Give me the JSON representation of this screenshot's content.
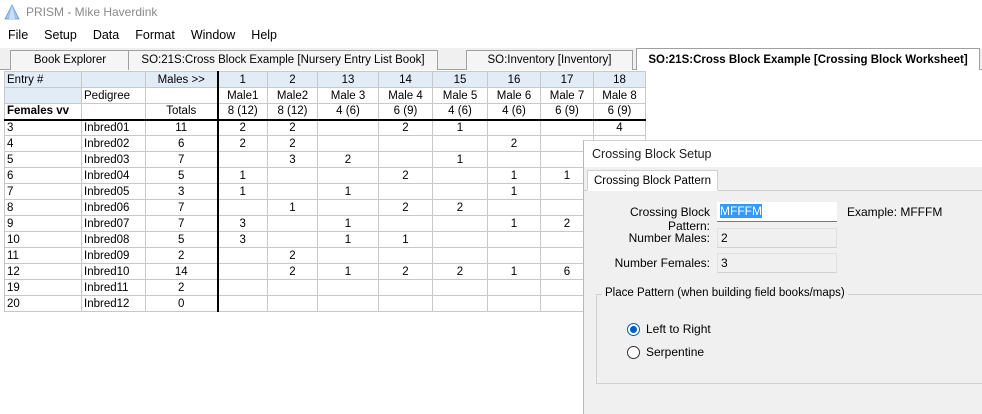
{
  "window": {
    "title": "PRISM - Mike Haverdink"
  },
  "menu": [
    "File",
    "Setup",
    "Data",
    "Format",
    "Window",
    "Help"
  ],
  "tabs": [
    {
      "label": "Book Explorer",
      "active": false
    },
    {
      "label": "SO:21S:Cross Block Example [Nursery Entry List Book]",
      "active": false
    },
    {
      "label": "SO:Inventory [Inventory]",
      "active": false
    },
    {
      "label": "SO:21S:Cross Block Example [Crossing Block Worksheet]",
      "active": true
    }
  ],
  "grid": {
    "corner_label": "Entry #",
    "males_header": "Males >>",
    "pedigree_label": "Pedigree",
    "females_label": "Females vv",
    "totals_label": "Totals",
    "male_entries": [
      "1",
      "2",
      "13",
      "14",
      "15",
      "16",
      "17",
      "18"
    ],
    "male_names": [
      "Male1",
      "Male2",
      "Male 3",
      "Male 4",
      "Male 5",
      "Male 6",
      "Male 7",
      "Male 8"
    ],
    "male_totals": [
      "8 (12)",
      "8 (12)",
      "4 (6)",
      "6 (9)",
      "4 (6)",
      "4 (6)",
      "6 (9)",
      "6 (9)"
    ],
    "rows": [
      {
        "entry": "3",
        "pedigree": "Inbred01",
        "total": "11",
        "cells": [
          "2",
          "2",
          "",
          "2",
          "1",
          "",
          "",
          "4"
        ]
      },
      {
        "entry": "4",
        "pedigree": "Inbred02",
        "total": "6",
        "cells": [
          "2",
          "2",
          "",
          "",
          "",
          "2",
          "",
          ""
        ]
      },
      {
        "entry": "5",
        "pedigree": "Inbred03",
        "total": "7",
        "cells": [
          "",
          "3",
          "2",
          "",
          "1",
          "",
          "",
          ""
        ]
      },
      {
        "entry": "6",
        "pedigree": "Inbred04",
        "total": "5",
        "cells": [
          "1",
          "",
          "",
          "2",
          "",
          "1",
          "1",
          ""
        ]
      },
      {
        "entry": "7",
        "pedigree": "Inbred05",
        "total": "3",
        "cells": [
          "1",
          "",
          "1",
          "",
          "",
          "1",
          "",
          ""
        ]
      },
      {
        "entry": "8",
        "pedigree": "Inbred06",
        "total": "7",
        "cells": [
          "",
          "1",
          "",
          "2",
          "2",
          "",
          "",
          ""
        ]
      },
      {
        "entry": "9",
        "pedigree": "Inbred07",
        "total": "7",
        "cells": [
          "3",
          "",
          "1",
          "",
          "",
          "1",
          "2",
          ""
        ]
      },
      {
        "entry": "10",
        "pedigree": "Inbred08",
        "total": "5",
        "cells": [
          "3",
          "",
          "1",
          "1",
          "",
          "",
          "",
          ""
        ]
      },
      {
        "entry": "11",
        "pedigree": "Inbred09",
        "total": "2",
        "cells": [
          "",
          "2",
          "",
          "",
          "",
          "",
          "",
          ""
        ]
      },
      {
        "entry": "12",
        "pedigree": "Inbred10",
        "total": "14",
        "cells": [
          "",
          "2",
          "1",
          "2",
          "2",
          "1",
          "6",
          ""
        ]
      },
      {
        "entry": "19",
        "pedigree": "Inbred11",
        "total": "2",
        "cells": [
          "",
          "",
          "",
          "",
          "",
          "",
          "",
          ""
        ]
      },
      {
        "entry": "20",
        "pedigree": "Inbred12",
        "total": "0",
        "cells": [
          "",
          "",
          "",
          "",
          "",
          "",
          "",
          ""
        ]
      }
    ]
  },
  "dialog": {
    "title": "Crossing Block Setup",
    "tab_label": "Crossing Block Pattern",
    "pattern_label": "Crossing Block Pattern:",
    "pattern_value": "MFFFM",
    "example_text": "Example: MFFFM",
    "males_label": "Number Males:",
    "males_value": "2",
    "females_label": "Number Females:",
    "females_value": "3",
    "group_label": "Place Pattern (when building field books/maps)",
    "radio_ltr": "Left to Right",
    "radio_serp": "Serpentine",
    "selected_radio": "Left to Right"
  },
  "colors": {
    "header_bg": "#e2ecf7",
    "dialog_bg": "#f0f0f0",
    "accent": "#005fb8"
  }
}
